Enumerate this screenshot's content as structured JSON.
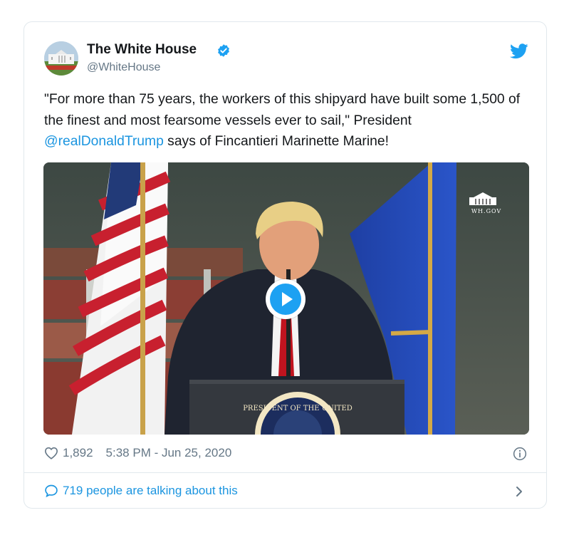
{
  "tweet": {
    "author_name": "The White House",
    "author_handle": "@WhiteHouse",
    "text_before": "\"For more than 75 years, the workers of this shipyard have built some 1,500 of the finest and most fearsome vessels ever to sail,\" President ",
    "mention": "@realDonaldTrump",
    "text_after": " says of Fincantieri Marinette Marine!",
    "likes": "1,892",
    "timestamp": "5:38 PM - Jun 25, 2020",
    "talking": "719 people are talking about this"
  },
  "media": {
    "watermark": "WH.GOV",
    "seal_text": "PRESIDENT OF THE UNITED"
  },
  "icons": {
    "verified": "verified-badge-icon",
    "brand": "twitter-bird-icon",
    "like": "heart-icon",
    "info": "info-icon",
    "reply": "speech-bubble-icon",
    "more": "chevron-right-icon",
    "play": "play-icon"
  },
  "colors": {
    "accent": "#1b95e0",
    "muted": "#657786",
    "border": "#e1e8ed"
  }
}
